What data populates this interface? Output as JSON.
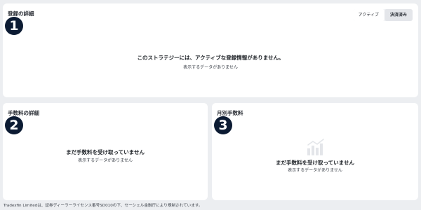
{
  "subscriptions": {
    "title": "登録の詳細",
    "badge": "1",
    "tabs": [
      {
        "label": "アクティブ",
        "selected": false
      },
      {
        "label": "決済済み",
        "selected": true
      }
    ],
    "empty_title": "このストラテジーには、アクティブな登録情報がありません。",
    "empty_subtitle": "表示するデータがありません"
  },
  "fees": {
    "title": "手数料の詳細",
    "badge": "2",
    "empty_title": "まだ手数料を受け取っていません",
    "empty_subtitle": "表示するデータがありません"
  },
  "monthly_fees": {
    "title": "月別手数料",
    "badge": "3",
    "icon": "bar-chart-icon",
    "empty_title": "まだ手数料を受け取っていません",
    "empty_subtitle": "表示するデータがありません"
  },
  "footer": {
    "text": "Tradexfin Limitedは、証券ディーラーライセンス番号SD010の下、セーシェル金融庁により規制されています。"
  },
  "colors": {
    "background": "#eceef1",
    "card": "#ffffff",
    "badge": "#0c1b33",
    "icon": "#e3e5e9"
  }
}
